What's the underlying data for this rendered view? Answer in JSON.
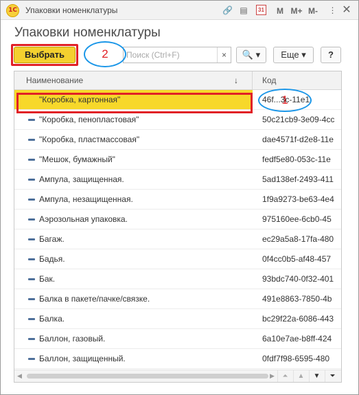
{
  "window": {
    "logo": "1С",
    "title": "Упаковки номенклатуры",
    "titlebar_icons": [
      "link-icon",
      "document-icon",
      "calendar-icon"
    ],
    "calendar_label": "31",
    "memory_buttons": [
      "M",
      "M+",
      "M-"
    ],
    "menu_glyph": "⋮",
    "close_glyph": "✕"
  },
  "form": {
    "title": "Упаковки номенклатуры"
  },
  "toolbar": {
    "select_label": "Выбрать",
    "search_placeholder": "Поиск (Ctrl+F)",
    "search_clear": "×",
    "find_label": "🔍 ▾",
    "more_label": "Еще ▾",
    "help_label": "?"
  },
  "annotations": {
    "callout_1": "1",
    "callout_2": "2",
    "colors": {
      "highlight_border": "#e12026",
      "callout_border": "#1a96e8",
      "selected_row": "#f7d82a"
    }
  },
  "table": {
    "columns": {
      "name": "Наименование",
      "code": "Код",
      "sort_glyph": "↓"
    },
    "selected_index": 0,
    "rows": [
      {
        "name": "\"Коробка, картонная\"",
        "code": "46f...3c-11e1"
      },
      {
        "name": "\"Коробка, пенопластовая\"",
        "code": "50c21cb9-3e09-4cc"
      },
      {
        "name": "\"Коробка, пластмассовая\"",
        "code": "dae4571f-d2e8-11e"
      },
      {
        "name": "\"Мешок, бумажный\"",
        "code": "fedf5e80-053c-11e"
      },
      {
        "name": "Ампула, защищенная.",
        "code": "5ad138ef-2493-411"
      },
      {
        "name": "Ампула, незащищенная.",
        "code": "1f9a9273-be63-4e4"
      },
      {
        "name": "Аэрозольная упаковка.",
        "code": "975160ee-6cb0-45"
      },
      {
        "name": "Багаж.",
        "code": "ec29a5a8-17fa-480"
      },
      {
        "name": "Бадья.",
        "code": "0f4cc0b5-af48-457"
      },
      {
        "name": "Бак.",
        "code": "93bdc740-0f32-401"
      },
      {
        "name": "Балка в пакете/пачке/связке.",
        "code": "491e8863-7850-4b"
      },
      {
        "name": "Балка.",
        "code": "bc29f22a-6086-443"
      },
      {
        "name": "Баллон, газовый.",
        "code": "6a10e7ae-b8ff-424"
      },
      {
        "name": "Баллон, защищенный.",
        "code": "0fdf7f98-6595-480"
      }
    ]
  },
  "scroll_nav": [
    "⏶",
    "▲",
    "▼",
    "⏷"
  ]
}
